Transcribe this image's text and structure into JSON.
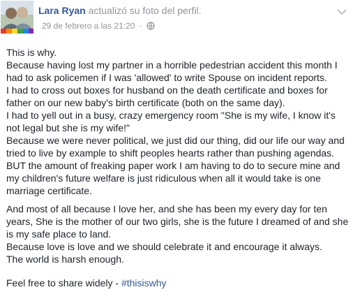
{
  "header": {
    "author": "Lara Ryan",
    "action": "actualizó su foto del perfil.",
    "timestamp": "29 de febrero a las 21:20",
    "separator": "·",
    "privacy_icon": "globe-icon",
    "menu_icon": "chevron-down-icon"
  },
  "post": {
    "paragraph1": [
      "This is why.",
      "Because having lost my partner in a horrible pedestrian accident this month I had to ask policemen if I was 'allowed' to write Spouse on incident reports.",
      "I had to cross out boxes for husband on the death certificate and boxes for father on our new baby's birth certificate (both on the same day).",
      "I had to yell out in a busy, crazy emergency room \"She is my wife, I know it's not legal but she is my wife!\"",
      "Because we were never political, we just did our thing, did our life our way and tried to live by example to shift peoples hearts rather than pushing agendas.",
      "BUT the amount of freaking paper work I am having to do to secure mine and my children's future welfare is just ridiculous when all it would take is one marriage certificate."
    ],
    "paragraph2": [
      "And most of all because I love her, and she has been my every day for ten years, She is the mother of our two girls, she is the future I dreamed of and she is my safe place to land.",
      "Because love is love and we should celebrate it and encourage it always.",
      "The world is harsh enough."
    ],
    "footer_text": "Feel free to share widely - ",
    "hashtag": "#thisiswhy"
  },
  "colors": {
    "link": "#365899",
    "meta": "#90949c",
    "text": "#1d2129"
  }
}
